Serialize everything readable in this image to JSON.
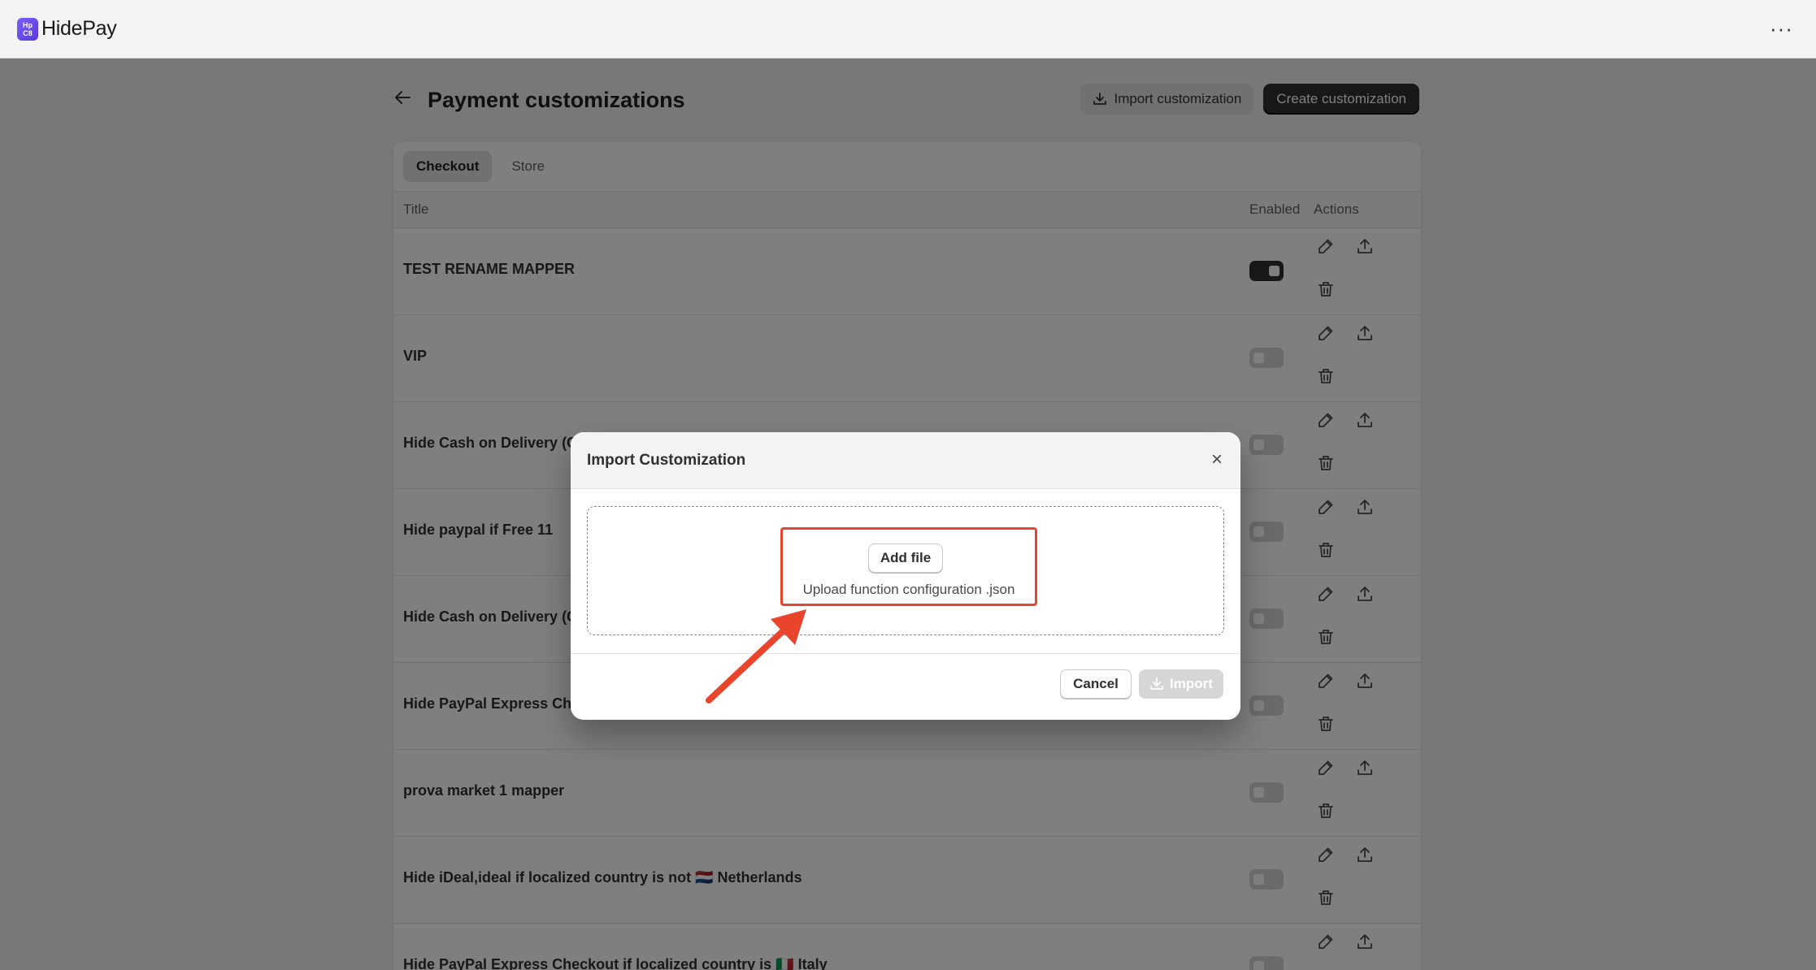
{
  "app": {
    "name": "HidePay",
    "logo_text_top": "Hp",
    "logo_text_bottom": "C8",
    "more_label": "···"
  },
  "page": {
    "title": "Payment customizations",
    "import_button": "Import customization",
    "create_button": "Create customization"
  },
  "tabs": [
    {
      "label": "Checkout",
      "active": true
    },
    {
      "label": "Store",
      "active": false
    }
  ],
  "table": {
    "headers": {
      "title": "Title",
      "enabled": "Enabled",
      "actions": "Actions"
    },
    "rows": [
      {
        "title": "TEST RENAME MAPPER",
        "enabled": true
      },
      {
        "title": "VIP",
        "enabled": false
      },
      {
        "title": "Hide Cash on Delivery (C",
        "enabled": false
      },
      {
        "title": "Hide paypal if Free 11",
        "enabled": false
      },
      {
        "title": "Hide Cash on Delivery (C",
        "enabled": false
      },
      {
        "title": "Hide PayPal Express Che",
        "enabled": false
      },
      {
        "title": "prova market 1 mapper",
        "enabled": false
      },
      {
        "title": "Hide iDeal,ideal if localized country is not 🇳🇱 Netherlands",
        "enabled": false
      },
      {
        "title": "Hide PayPal Express Checkout if localized country is 🇮🇹 Italy",
        "enabled": false
      }
    ]
  },
  "modal": {
    "title": "Import Customization",
    "close_label": "×",
    "add_file_button": "Add file",
    "upload_hint": "Upload function configuration .json",
    "cancel_button": "Cancel",
    "import_button": "Import"
  },
  "colors": {
    "primary_button": "#303030",
    "annotation": "#e8452c",
    "overlay": "rgba(0,0,0,0.5)"
  }
}
